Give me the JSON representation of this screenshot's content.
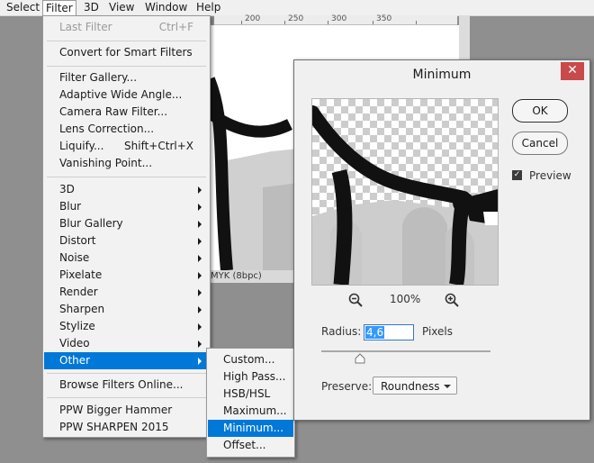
{
  "menubar": {
    "items": [
      "Select",
      "Filter",
      "3D",
      "View",
      "Window",
      "Help"
    ]
  },
  "ruler": {
    "ticks": [
      "200",
      "250",
      "300",
      "350"
    ]
  },
  "document": {
    "status": "MYK (8bpc)"
  },
  "filter_menu": {
    "last_filter": "Last Filter",
    "last_filter_shortcut": "Ctrl+F",
    "convert": "Convert for Smart Filters",
    "gallery": "Filter Gallery...",
    "adaptive": "Adaptive Wide Angle...",
    "camera_raw": "Camera Raw Filter...",
    "lens": "Lens Correction...",
    "liquify": "Liquify...",
    "liquify_shortcut": "Shift+Ctrl+X",
    "vanishing": "Vanishing Point...",
    "groups": [
      "3D",
      "Blur",
      "Blur Gallery",
      "Distort",
      "Noise",
      "Pixelate",
      "Render",
      "Sharpen",
      "Stylize",
      "Video",
      "Other"
    ],
    "browse": "Browse Filters Online...",
    "plugins": [
      "PPW Bigger Hammer",
      "PPW SHARPEN 2015"
    ]
  },
  "other_submenu": {
    "items": [
      "Custom...",
      "High Pass...",
      "HSB/HSL",
      "Maximum...",
      "Minimum...",
      "Offset..."
    ],
    "selected": "Minimum..."
  },
  "dialog": {
    "title": "Minimum",
    "close": "✕",
    "ok": "OK",
    "cancel": "Cancel",
    "preview_label": "Preview",
    "preview_checked": true,
    "zoom": "100%",
    "radius_label": "Radius:",
    "radius_value": "4,6",
    "radius_unit": "Pixels",
    "preserve_label": "Preserve:",
    "preserve_value": "Roundness"
  },
  "colors": {
    "highlight": "#0078d7",
    "close": "#c94a4a"
  }
}
